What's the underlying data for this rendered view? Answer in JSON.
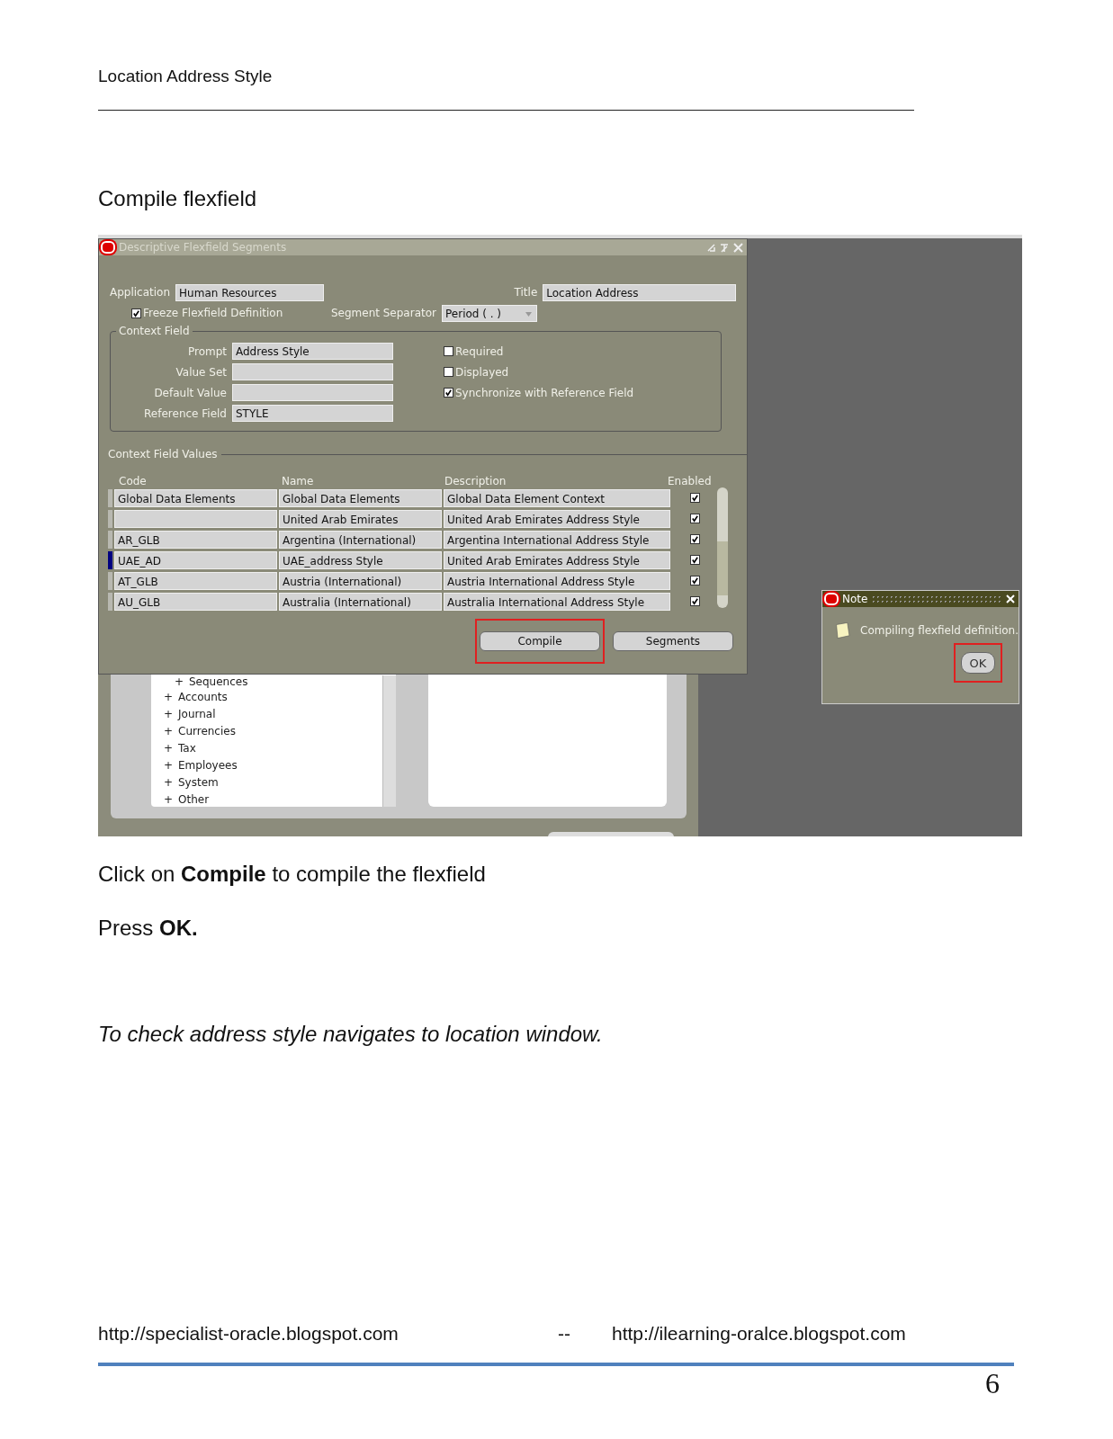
{
  "document": {
    "header": "Location Address Style",
    "heading": "Compile flexfield",
    "instructions": [
      "Click on **Compile** to compile the flexfield",
      "Press **OK.**"
    ],
    "note": "To check address style navigates to location window.",
    "footer": {
      "left": "http://specialist-oracle.blogspot.com",
      "separator": "--",
      "right": "http://ilearning-oralce.blogspot.com"
    },
    "page_number": "6"
  },
  "screenshot": {
    "dialog": {
      "title": "Descriptive Flexfield Segments",
      "application_label": "Application",
      "application": "Human Resources",
      "title_label": "Title",
      "title_value": "Location Address",
      "freeze": {
        "label": "Freeze Flexfield Definition",
        "checked": true
      },
      "separator_label": "Segment Separator",
      "separator": "Period ( . )",
      "context_field": {
        "legend": "Context Field",
        "fields": [
          {
            "label": "Prompt",
            "value": "Address Style"
          },
          {
            "label": "Value Set"
          },
          {
            "label": "Default Value"
          },
          {
            "label": "Reference Field",
            "value": "STYLE"
          }
        ],
        "options": [
          {
            "label": "Required",
            "checked": false
          },
          {
            "label": "Displayed",
            "checked": false
          },
          {
            "label": "Synchronize with Reference Field",
            "checked": true
          }
        ]
      },
      "values": {
        "legend": "Context Field Values",
        "columns": [
          "Code",
          "Name",
          "Description",
          "Enabled"
        ],
        "rows": [
          {
            "code": "Global Data Elements",
            "name": "Global Data Elements",
            "description": "Global Data Element Context",
            "enabled": true,
            "selected": false
          },
          {
            "name": "United Arab Emirates",
            "description": "United Arab Emirates Address Style",
            "enabled": true,
            "selected": false
          },
          {
            "code": "AR_GLB",
            "name": "Argentina (International)",
            "description": "Argentina International Address Style",
            "enabled": true,
            "selected": false
          },
          {
            "code": "UAE_AD",
            "name": "UAE_address Style",
            "description": "United Arab Emirates Address Style",
            "enabled": true,
            "selected": true
          },
          {
            "code": "AT_GLB",
            "name": "Austria (International)",
            "description": "Austria International Address Style",
            "enabled": true,
            "selected": false
          },
          {
            "code": "AU_GLB",
            "name": "Australia (International)",
            "description": "Australia International Address Style",
            "enabled": true,
            "selected": false
          }
        ]
      },
      "buttons": [
        {
          "label": "Compile",
          "highlighted": true
        },
        {
          "label": "Segments",
          "highlighted": false
        }
      ]
    },
    "tree": {
      "items": [
        {
          "sign": "+",
          "label": "Sequences"
        },
        {
          "sign": "+",
          "label": "Accounts"
        },
        {
          "sign": "+",
          "label": "Journal"
        },
        {
          "sign": "+",
          "label": "Currencies"
        },
        {
          "sign": "+",
          "label": "Tax"
        },
        {
          "sign": "+",
          "label": "Employees"
        },
        {
          "sign": "+",
          "label": "System"
        },
        {
          "sign": "+",
          "label": "Other"
        }
      ]
    },
    "note": {
      "title": "Note",
      "message": "Compiling flexfield definition.",
      "button": {
        "label": "OK",
        "highlighted": true
      }
    }
  }
}
